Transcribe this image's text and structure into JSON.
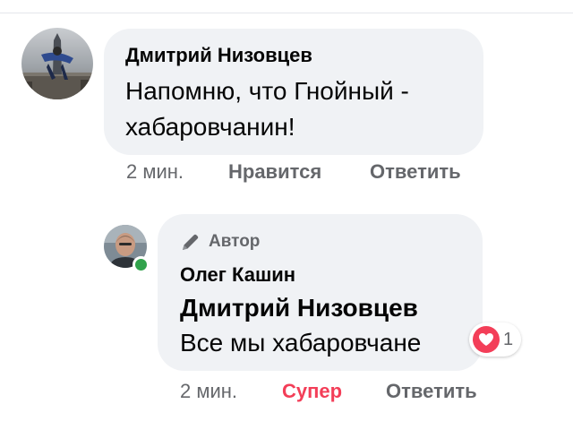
{
  "colors": {
    "bubble_bg": "#f0f2f5",
    "text_primary": "#050505",
    "text_secondary": "#65676b",
    "love_red": "#f33e58",
    "online_green": "#31a24c"
  },
  "comment": {
    "author": "Дмитрий Низовцев",
    "text": "Напомню, что Гнойный - хабаровчанин!",
    "time": "2 мин.",
    "like_label": "Нравится",
    "reply_label": "Ответить",
    "avatar_icon": "avatar-photo"
  },
  "reply": {
    "badge_icon": "pencil-icon",
    "badge_label": "Автор",
    "author": "Олег Кашин",
    "mention": "Дмитрий Низовцев",
    "text": "Все мы хабаровчане",
    "time": "2 мин.",
    "reaction_label": "Супер",
    "reply_label": "Ответить",
    "reaction_icon": "heart-icon",
    "reaction_count": "1",
    "online": true
  }
}
